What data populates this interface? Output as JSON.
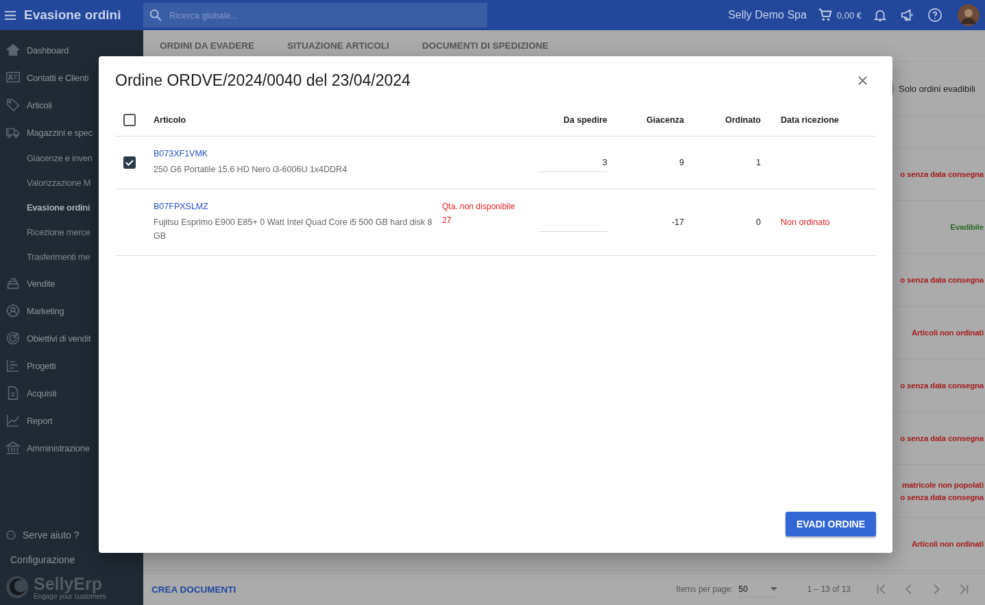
{
  "header": {
    "title": "Evasione ordini",
    "search_placeholder": "Ricerca globale...",
    "company": "Selly Demo Spa",
    "cart_total": "0,00 €"
  },
  "sidebar": {
    "items": [
      {
        "label": "Dashboard"
      },
      {
        "label": "Contatti e Clienti"
      },
      {
        "label": "Articoli"
      },
      {
        "label": "Magazzini e spec",
        "children": [
          {
            "label": "Giacenze e inven",
            "selected": false
          },
          {
            "label": "Valorizzazione M",
            "selected": false
          },
          {
            "label": "Evasione ordini",
            "selected": true
          },
          {
            "label": "Ricezione merce",
            "selected": false
          },
          {
            "label": "Trasferimenti me",
            "selected": false
          }
        ]
      },
      {
        "label": "Vendite"
      },
      {
        "label": "Marketing"
      },
      {
        "label": "Obiettivi di vendit"
      },
      {
        "label": "Progetti"
      },
      {
        "label": "Acquisti"
      },
      {
        "label": "Report"
      },
      {
        "label": "Amministrazione"
      }
    ],
    "help": "Serve aiuto ?",
    "config": "Configurazione",
    "logo": "SellyErp",
    "tagline": "Engage your customers"
  },
  "tabs": [
    {
      "label": "ORDINI DA EVADERE"
    },
    {
      "label": "SITUAZIONE ARTICOLI"
    },
    {
      "label": "DOCUMENTI DI SPEDIZIONE"
    }
  ],
  "filter_label": "Solo ordini evadibili",
  "status_rows": [
    {
      "lines": []
    },
    {
      "lines": [
        {
          "text": "o senza data consegna",
          "kind": "error"
        }
      ]
    },
    {
      "lines": [
        {
          "text": "Evadibile",
          "kind": "ok"
        }
      ]
    },
    {
      "lines": [
        {
          "text": "o senza data consegna",
          "kind": "error"
        }
      ]
    },
    {
      "lines": [
        {
          "text": "Articoli non ordinati",
          "kind": "error"
        }
      ]
    },
    {
      "lines": [
        {
          "text": "o senza data consegna",
          "kind": "error"
        }
      ]
    },
    {
      "lines": [
        {
          "text": "o senza data consegna",
          "kind": "error"
        }
      ]
    },
    {
      "lines": [
        {
          "text": "matricole non popolati",
          "kind": "error"
        },
        {
          "text": "o senza data consegna",
          "kind": "error"
        }
      ]
    },
    {
      "lines": [
        {
          "text": "Articoli non ordinati",
          "kind": "error"
        }
      ]
    }
  ],
  "footer": {
    "action": "CREA DOCUMENTI",
    "items_per_page_label": "Items per page:",
    "items_per_page": "50",
    "range": "1 – 13 of 13"
  },
  "modal": {
    "title": "Ordine ORDVE/2024/0040 del 23/04/2024",
    "select_all_checked": false,
    "columns": [
      "Articolo",
      "Da spedire",
      "Giacenza",
      "Ordinato",
      "Data ricezione"
    ],
    "rows": [
      {
        "kind": "selectable",
        "checked": true,
        "code": "B073XF1VMK",
        "description": "250 G6 Portatile 15.6 HD Nero i3-6006U 1x4DDR4",
        "to_ship": "3",
        "stock": "9",
        "ordered": "1"
      },
      {
        "kind": "locked",
        "code": "B07FPXSLMZ",
        "description": "Fujitsu Esprimo E900 E85+ 0 Watt Intel Quad Core i5 500 GB hard disk 8 GB",
        "warning": {
          "label": "Qta. non disponibile",
          "qty": "27"
        },
        "stock": "-17",
        "ordered": "0",
        "reception": "Non ordinato"
      }
    ],
    "button": "EVADI ORDINE"
  }
}
